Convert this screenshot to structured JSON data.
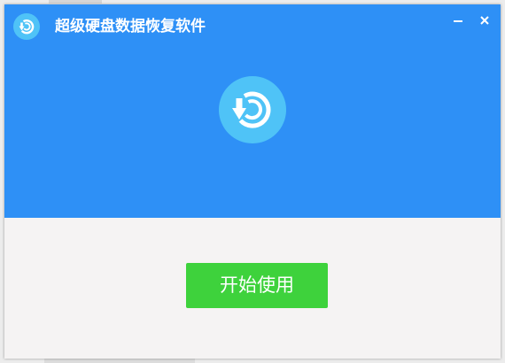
{
  "window": {
    "title": "超级硬盘数据恢复软件"
  },
  "titlebar": {
    "app_icon": "recovery-logo-icon",
    "minimize_icon": "minimize-icon",
    "close_icon": "close-icon"
  },
  "hero": {
    "icon": "recovery-logo-icon"
  },
  "actions": {
    "start_label": "开始使用"
  },
  "colors": {
    "header_blue": "#2e90f6",
    "logo_light_blue": "#4fc3f7",
    "start_green": "#3ed23c",
    "body_background": "#f5f3f3"
  }
}
